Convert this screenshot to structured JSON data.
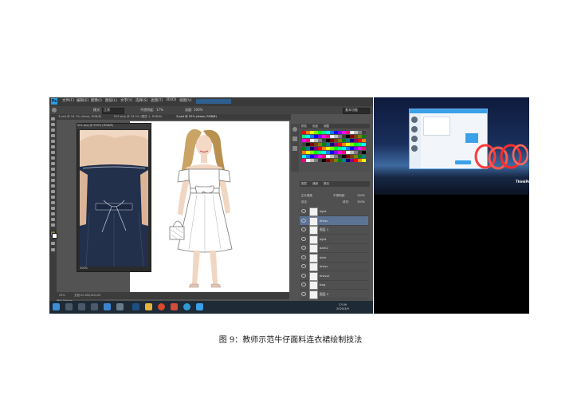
{
  "photoshop": {
    "logo": "Ps",
    "menu": [
      "文件(F)",
      "编辑(E)",
      "图像(I)",
      "图层(L)",
      "文字(Y)",
      "选择(S)",
      "滤镜(T)",
      "3D(D)",
      "视图(V)"
    ],
    "options": {
      "mode_label": "模式:",
      "mode_value": "正常",
      "opacity_label": "不透明度:",
      "opacity_value": "17%",
      "flow_label": "流量:",
      "flow_value": "100%",
      "workspace": "基本功能"
    },
    "tabs": [
      "3.psd @ 16.7% (dress, RGB/8)",
      "001.png @ 33.3% (图层 1, RGB/8)",
      "3.psd @ 25% (dress, RGB/8)"
    ],
    "reference_window": {
      "title": "001.png @ 300% (RGB/8)",
      "zoom": "300%"
    },
    "status": {
      "zoom": "25%",
      "doc": "文档:20.0M/184.2M"
    },
    "mini_bridge": "Mini Bridge",
    "panels": {
      "swatch_tabs": [
        "颜色",
        "色板",
        "调整"
      ],
      "layer_tabs": [
        "图层",
        "通道",
        "路径"
      ],
      "blend_mode": "正片叠底",
      "opacity_label": "不透明度:",
      "opacity_value": "100%",
      "lock_label": "锁定:",
      "fill_label": "填充:",
      "fill_value": "100%",
      "layers": [
        "light",
        "dress",
        "图层 1",
        "light",
        "dark2",
        "dark",
        "dress",
        "dress2",
        "bag",
        "图层 3"
      ]
    },
    "swatch_colors": [
      "#ff0000",
      "#ff8000",
      "#ffff00",
      "#80ff00",
      "#00ff00",
      "#00ff80",
      "#00ffff",
      "#0080ff",
      "#0000ff",
      "#8000ff",
      "#ff00ff",
      "#ff0080",
      "#ffffff",
      "#c0c0c0",
      "#808080",
      "#404040",
      "#000000",
      "#800000",
      "#804000",
      "#808000",
      "#008000",
      "#008080",
      "#000080",
      "#800080"
    ],
    "taskbar": {
      "time": "17:09",
      "date": "2020/3/9"
    }
  },
  "caption": "图 9：教师示范牛仔面料连衣裙绘制技法"
}
